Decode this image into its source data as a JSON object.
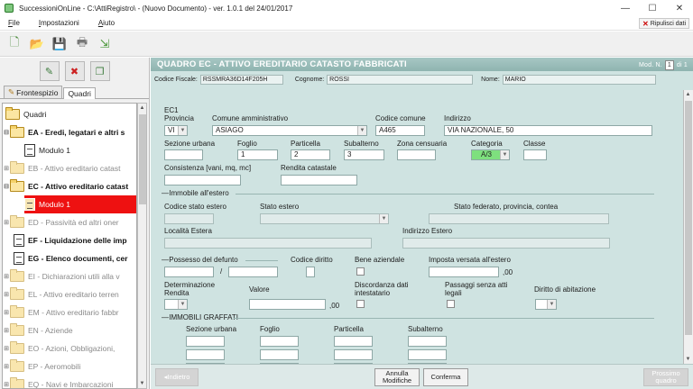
{
  "window": {
    "title": "SuccessioniOnLine - C:\\AttiRegistro\\ - (Nuovo Documento)  -  ver. 1.0.1 del 24/01/2017",
    "minimize": "—",
    "maximize": "☐",
    "close": "✕"
  },
  "menu": {
    "items": [
      "File",
      "Impostazioni",
      "Aiuto"
    ],
    "ripulisci": "Ripulisci dati"
  },
  "toolbar": {
    "new": "new-document-icon",
    "open": "open-folder-icon",
    "save": "save-icon",
    "print": "print-icon",
    "export": "export-icon"
  },
  "left": {
    "tabs": [
      "Frontespizio",
      "Quadri"
    ],
    "tree": [
      {
        "label": "Quadri",
        "kind": "folder-open",
        "state": "normal"
      },
      {
        "label": "EA - Eredi, legatari e altri s",
        "kind": "folder-open",
        "state": "bold"
      },
      {
        "label": "Modulo 1",
        "kind": "doc",
        "state": "normal"
      },
      {
        "label": "EB - Attivo ereditario catast",
        "kind": "folder",
        "state": "dim"
      },
      {
        "label": "EC - Attivo ereditario catast",
        "kind": "folder-open",
        "state": "bold"
      },
      {
        "label": "Modulo 1",
        "kind": "doc-edit",
        "state": "selected"
      },
      {
        "label": "ED - Passività ed altri oner",
        "kind": "folder",
        "state": "dim"
      },
      {
        "label": "EF - Liquidazione delle imp",
        "kind": "doc",
        "state": "bold"
      },
      {
        "label": "EG - Elenco documenti, cer",
        "kind": "doc",
        "state": "bold"
      },
      {
        "label": "EI - Dichiarazioni utili alla v",
        "kind": "folder",
        "state": "dim"
      },
      {
        "label": "EL - Attivo ereditario terren",
        "kind": "folder",
        "state": "dim"
      },
      {
        "label": "EM - Attivo ereditario fabbr",
        "kind": "folder",
        "state": "dim"
      },
      {
        "label": "EN - Aziende",
        "kind": "folder",
        "state": "dim"
      },
      {
        "label": "EO - Azioni, Obbligazioni, ",
        "kind": "folder",
        "state": "dim"
      },
      {
        "label": "EP - Aeromobili",
        "kind": "folder",
        "state": "dim"
      },
      {
        "label": "EQ - Navi e Imbarcazioni",
        "kind": "folder",
        "state": "dim"
      }
    ]
  },
  "main": {
    "title": "QUADRO EC - ATTIVO EREDITARIO CATASTO FABBRICATI",
    "mod_label": "Mod. N.",
    "mod_value": "1",
    "mod_of": "di 1",
    "id": {
      "cf_label": "Codice Fiscale:",
      "cf_value": "RSSMRA36D14F205H",
      "cognome_label": "Cognome:",
      "cognome_value": "ROSSI",
      "nome_label": "Nome:",
      "nome_value": "MARIO"
    },
    "form": {
      "section": "EC1",
      "provincia_label": "Provincia",
      "provincia_value": "VI",
      "comune_label": "Comune amministrativo",
      "comune_value": "ASIAGO",
      "codcomune_label": "Codice comune",
      "codcomune_value": "A465",
      "indirizzo_label": "Indirizzo",
      "indirizzo_value": "VIA NAZIONALE, 50",
      "sezione_label": "Sezione urbana",
      "foglio_label": "Foglio",
      "foglio_value": "1",
      "particella_label": "Particella",
      "particella_value": "2",
      "subalterno_label": "Subalterno",
      "subalterno_value": "3",
      "zona_label": "Zona censuaria",
      "categoria_label": "Categoria",
      "categoria_value": "A/3",
      "classe_label": "Classe",
      "consistenza_label": "Consistenza [vani, mq, mc]",
      "rendita_label": "Rendita catastale",
      "estero_section": "Immobile all'estero",
      "codestero_label": "Codice stato estero",
      "statoestero_label": "Stato estero",
      "statofed_label": "Stato federato, provincia, contea",
      "localita_label": "Località Estera",
      "indestero_label": "Indirizzo Estero",
      "possesso_label": "Possesso del defunto",
      "slash": "/",
      "coddiritto_label": "Codice diritto",
      "beniaz_label": "Bene aziendale",
      "imposta_label": "Imposta versata all'estero",
      "decimals": ",00",
      "detrendita_label": "Determinazione\nRendita",
      "valore_label": "Valore",
      "discordanza_label": "Discordanza dati\nintestatario",
      "passaggi_label": "Passaggi senza atti\nlegali",
      "dirittoabit_label": "Diritto di abitazione",
      "graffati_section": "IMMOBILI GRAFFATI",
      "g_sezione_label": "Sezione urbana",
      "g_foglio_label": "Foglio",
      "g_particella_label": "Particella",
      "g_subalterno_label": "Subalterno"
    },
    "footer": {
      "indietro": "Indietro",
      "annulla": "Annulla\nModifiche",
      "conferma": "Conferma",
      "avanti": "Prossimo\nquadro"
    }
  }
}
